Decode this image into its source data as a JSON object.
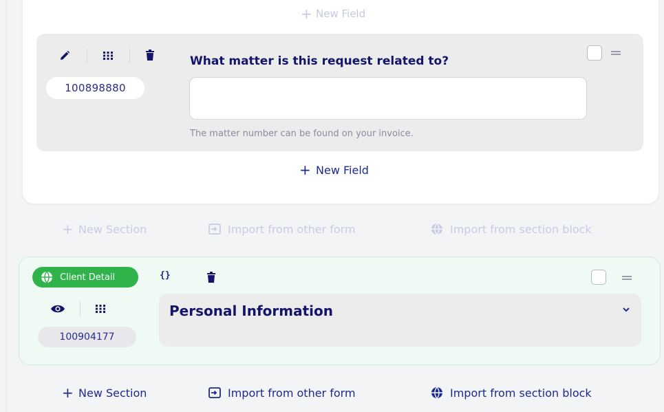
{
  "colors": {
    "primary": "#1d2a8c",
    "badge_green": "#2fb34a",
    "section_bg": "#effaf5",
    "field_bg": "#ececec"
  },
  "top_card": {
    "ghost_new_field_label": "New Field",
    "field": {
      "id": "100898880",
      "question": "What matter is this request related to?",
      "input_value": "",
      "help_text": "The matter number can be found on your invoice.",
      "icons": [
        "pencil-icon",
        "grid-icon",
        "trash-icon",
        "checkbox",
        "drag-handle-icon"
      ]
    },
    "new_field_label": "New Field"
  },
  "between_actions": {
    "new_section": "New Section",
    "import_form": "Import from other form",
    "import_block": "Import from section block"
  },
  "section": {
    "badge_label": "Client Detail",
    "code_icon_text": "{}",
    "id": "100904177",
    "title": "Personal Information",
    "icons": [
      "globe-icon",
      "code-braces-icon",
      "trash-icon",
      "eye-icon",
      "grid-icon",
      "chevron-down-icon",
      "checkbox",
      "drag-handle-icon"
    ]
  },
  "bottom_actions": {
    "new_section": "New Section",
    "import_form": "Import from other form",
    "import_block": "Import from section block"
  }
}
